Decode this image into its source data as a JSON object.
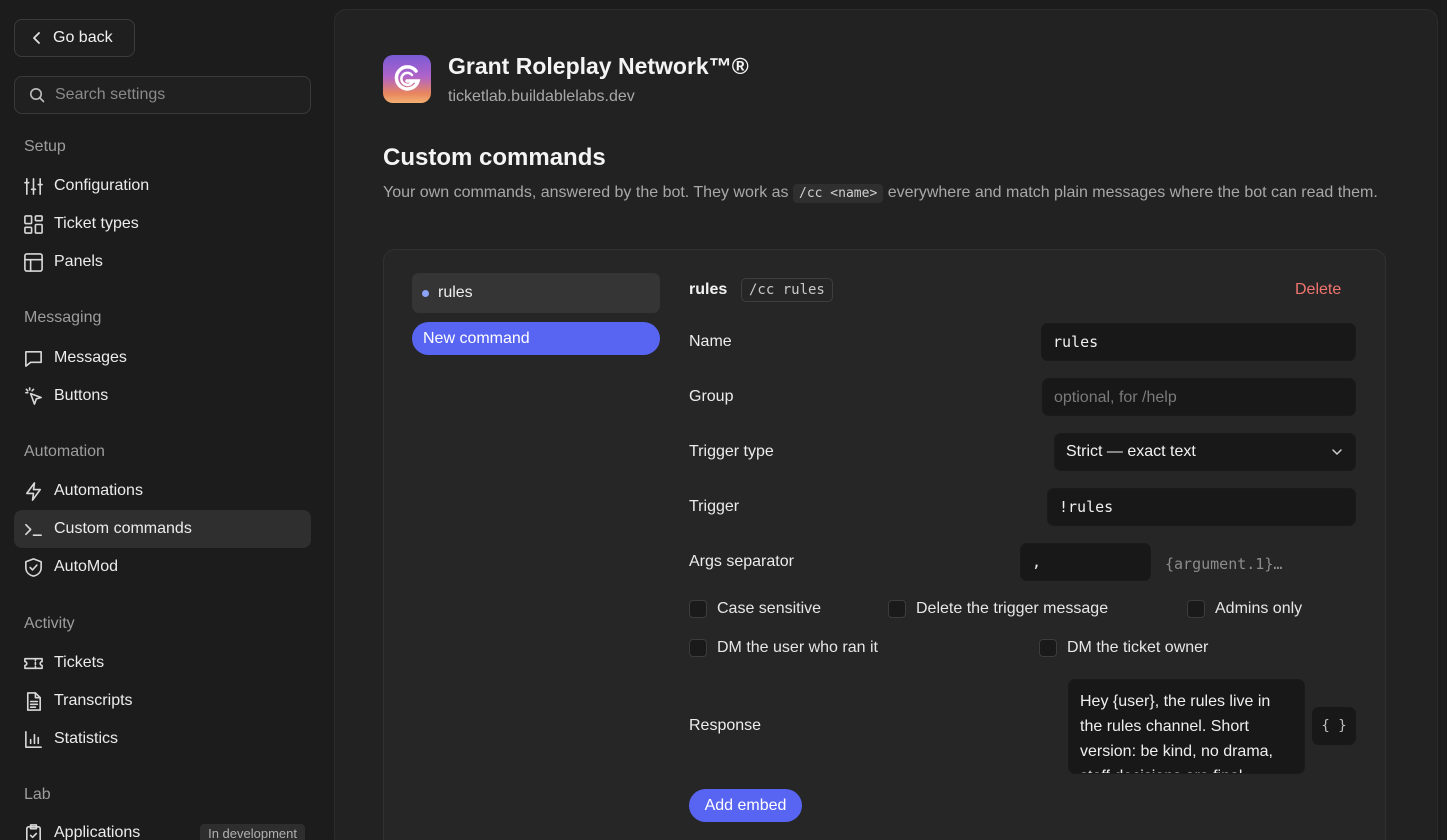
{
  "sidebar": {
    "go_back": "Go back",
    "search_placeholder": "Search settings",
    "sections": {
      "setup": "Setup",
      "messaging": "Messaging",
      "automation": "Automation",
      "activity": "Activity",
      "lab": "Lab"
    },
    "items": {
      "configuration": "Configuration",
      "ticket_types": "Ticket types",
      "panels": "Panels",
      "messages": "Messages",
      "buttons": "Buttons",
      "automations": "Automations",
      "custom_commands": "Custom commands",
      "automod": "AutoMod",
      "tickets": "Tickets",
      "transcripts": "Transcripts",
      "statistics": "Statistics",
      "applications": "Applications"
    },
    "applications_badge": "In development",
    "active_item": "custom_commands"
  },
  "server": {
    "name": "Grant Roleplay Network™®",
    "domain": "ticketlab.buildablelabs.dev"
  },
  "page": {
    "title": "Custom commands",
    "desc_before": "Your own commands, answered by the bot. They work as ",
    "desc_code": "/cc <name>",
    "desc_after": " everywhere and match plain messages where the bot can read them."
  },
  "commands": {
    "list": [
      "rules"
    ],
    "new_label": "New command"
  },
  "editor": {
    "title": "rules",
    "chip": "/cc rules",
    "delete_label": "Delete",
    "name_label": "Name",
    "name_value": "rules",
    "group_label": "Group",
    "group_placeholder": "optional, for /help",
    "trigger_type_label": "Trigger type",
    "trigger_type_value": "Strict — exact text",
    "trigger_label": "Trigger",
    "trigger_value": "!rules",
    "args_label": "Args separator",
    "args_value": ",",
    "args_hint": "{argument.1}…",
    "checkboxes": {
      "case_sensitive": "Case sensitive",
      "delete_trigger": "Delete the trigger message",
      "admins_only": "Admins only",
      "dm_user": "DM the user who ran it",
      "dm_owner": "DM the ticket owner"
    },
    "response_label": "Response",
    "response_value": "Hey {user}, the rules live in the rules channel. Short version: be kind, no drama, staff decisions are final.",
    "var_button": "{ }",
    "add_embed_label": "Add embed"
  },
  "colors": {
    "accent": "#5865f2",
    "danger": "#f07470",
    "background": "#1c1c1c",
    "panel": "#222222"
  }
}
